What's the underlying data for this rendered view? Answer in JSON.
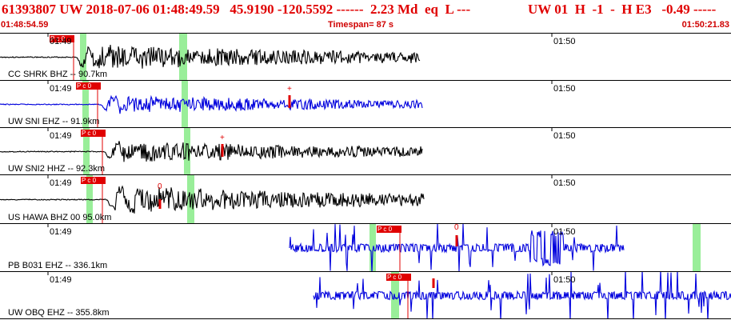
{
  "header": {
    "title_left": "61393807 UW 2018-07-06 01:48:49.59   45.9190 -120.5592 ------  2.23 Md  eq  L ---",
    "title_right": "UW 01  H  -1  -  H E3   -0.49 -----",
    "start_time": "01:48:54.59",
    "timespan": "Timespan=  87 s",
    "end_time": "01:50:21.83"
  },
  "colors": {
    "title": "#e00000",
    "trace_black": "#000000",
    "trace_blue": "#0000dd",
    "pick": "#e00000",
    "window": "#99ee99"
  },
  "panels": [
    {
      "station": "CC SHRK BHZ -- 90.7km",
      "tick_left": "01:49",
      "tick_right": "01:50",
      "pick_label": "P c 0",
      "qual": "-",
      "trace_color": "black"
    },
    {
      "station": "UW SNI EHZ -- 91.9km",
      "tick_left": "01:49",
      "tick_right": "01:50",
      "pick_label": "P c 0",
      "qual": "+",
      "trace_color": "blue"
    },
    {
      "station": "UW SNI2 HHZ -- 92.3km",
      "tick_left": "01:49",
      "tick_right": "01:50",
      "pick_label": "P c 0",
      "qual": "+",
      "trace_color": "black"
    },
    {
      "station": "US HAWA BHZ 00 95.0km",
      "tick_left": "01:49",
      "tick_right": "01:50",
      "pick_label": "P c 0",
      "qual": "0",
      "trace_color": "black"
    },
    {
      "station": "PB B031 EHZ -- 336.1km",
      "tick_left": "01:49",
      "tick_right": "01:50",
      "pick_label": "P c 0",
      "qual": "0",
      "trace_color": "blue"
    },
    {
      "station": "UW OBQ EHZ -- 355.8km",
      "tick_left": "01:49",
      "tick_right": "01:50",
      "pick_label": "P c 0",
      "qual": "",
      "trace_color": "blue"
    }
  ]
}
